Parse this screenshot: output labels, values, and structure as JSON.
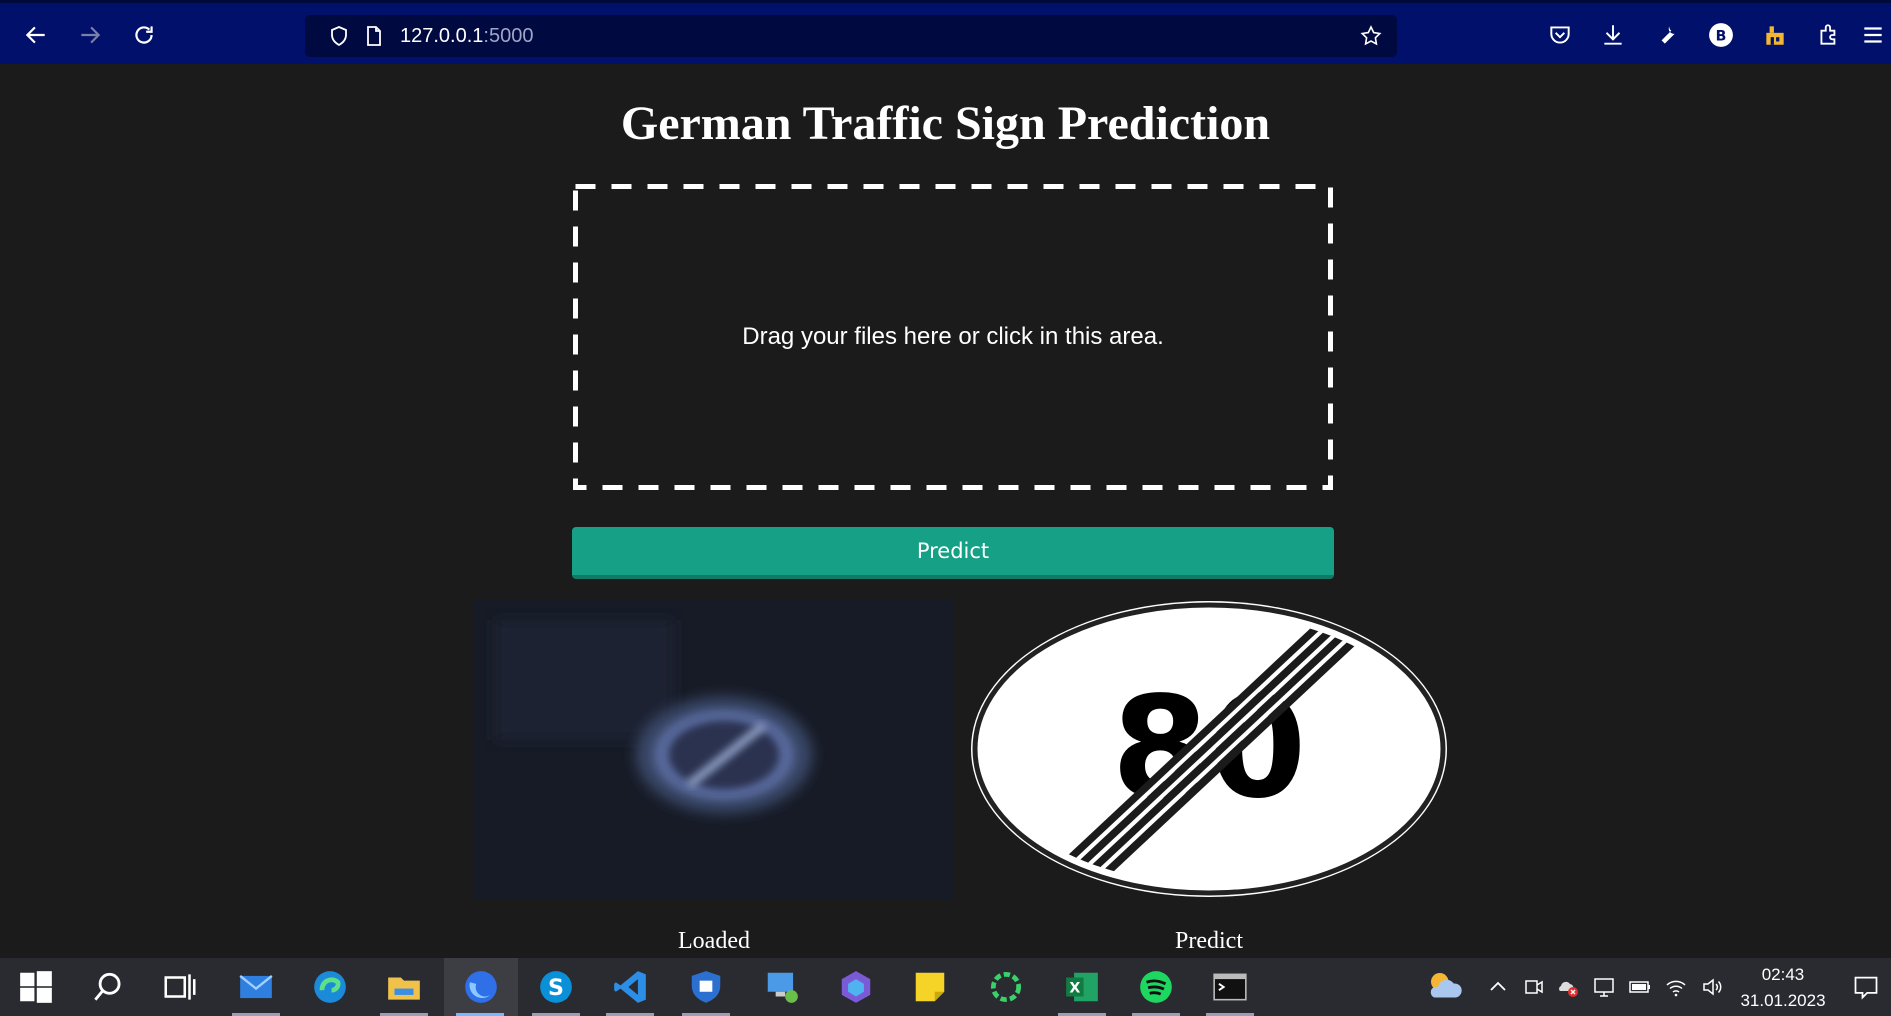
{
  "browser": {
    "url_host": "127.0.0.1",
    "url_port": ":5000",
    "profile_initial": "B"
  },
  "page": {
    "title": "German Traffic Sign Prediction",
    "dropzone_text": "Drag your files here or click in this area.",
    "predict_button": "Predict",
    "loaded_caption": "Loaded",
    "predict_caption": "Predict",
    "predicted_sign_number": "80",
    "accent_color": "#16a085"
  },
  "taskbar": {
    "time": "02:43",
    "date": "31.01.2023",
    "apps": [
      "start-icon",
      "search-icon",
      "task-view-icon",
      "mail-icon",
      "edge-icon",
      "file-explorer-icon",
      "firefox-icon",
      "skype-icon",
      "vscode-icon",
      "security-icon",
      "remote-desktop-icon",
      "copilot-icon",
      "sticky-notes-icon",
      "loader-icon",
      "excel-icon",
      "spotify-icon",
      "terminal-icon"
    ]
  }
}
